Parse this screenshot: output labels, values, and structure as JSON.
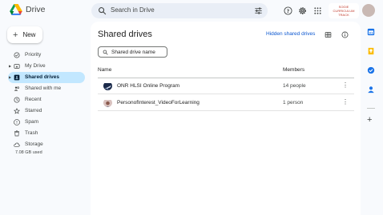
{
  "app": {
    "title": "Drive"
  },
  "search": {
    "placeholder": "Search in Drive"
  },
  "header": {
    "brand_text": "SOGIE CURRICULUM TRACK",
    "icons": [
      "drive-logo-icon",
      "search-icon",
      "tune-icon",
      "help-icon",
      "settings-icon",
      "apps-grid-icon",
      "account-avatar"
    ]
  },
  "sidebar": {
    "new_label": "New",
    "items": [
      {
        "label": "Priority",
        "icon": "priority-check-icon",
        "active": false
      },
      {
        "label": "My Drive",
        "icon": "my-drive-icon",
        "active": false
      },
      {
        "label": "Shared drives",
        "icon": "shared-drives-icon",
        "active": true
      },
      {
        "label": "Shared with me",
        "icon": "shared-with-me-icon",
        "active": false
      },
      {
        "label": "Recent",
        "icon": "clock-icon",
        "active": false
      },
      {
        "label": "Starred",
        "icon": "star-icon",
        "active": false
      },
      {
        "label": "Spam",
        "icon": "spam-icon",
        "active": false
      },
      {
        "label": "Trash",
        "icon": "trash-icon",
        "active": false
      },
      {
        "label": "Storage",
        "icon": "cloud-icon",
        "active": false
      }
    ],
    "storage_used": "7.08 GB used"
  },
  "main": {
    "title": "Shared drives",
    "hidden_link": "Hidden shared drives",
    "filter_placeholder": "Shared drive name",
    "columns": {
      "name": "Name",
      "members": "Members"
    },
    "rows": [
      {
        "name": "ONR HLSI Online Program",
        "members": "14 people",
        "thumb": "drive-thumb-plane"
      },
      {
        "name": "PersonofInterest_VideoForLearning",
        "members": "1 person",
        "thumb": "drive-thumb-person"
      }
    ]
  },
  "right_rail": {
    "icons": [
      "calendar-icon",
      "keep-icon",
      "tasks-icon",
      "contacts-icon",
      "add-icon"
    ],
    "colors": {
      "calendar": "#1a73e8",
      "keep": "#fbbc04",
      "tasks": "#1a73e8",
      "contacts": "#1a73e8"
    }
  },
  "colors": {
    "accent": "#0b57d0",
    "active_bg": "#c2e7ff",
    "page_bg": "#f8fafd"
  }
}
